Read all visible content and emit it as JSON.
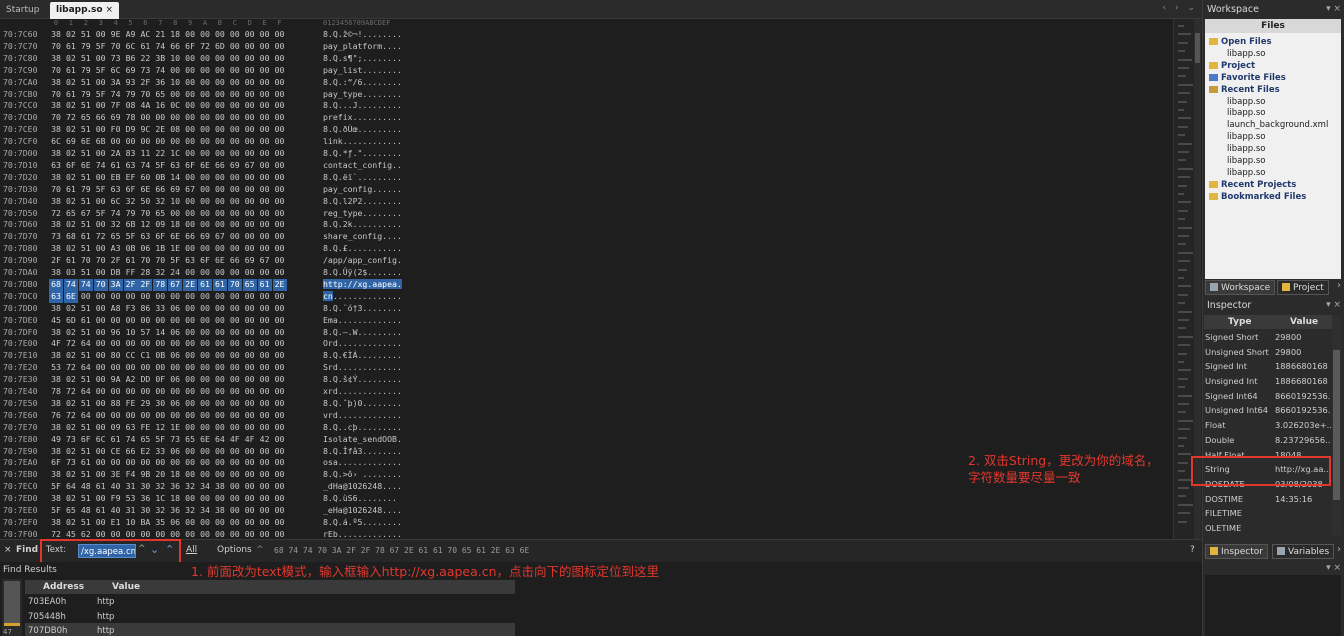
{
  "tabs": [
    {
      "label": "Startup",
      "active": false
    },
    {
      "label": "libapp.so",
      "active": true,
      "close": "×"
    }
  ],
  "tabnav": "‹ › ⌄",
  "hex_header": [
    "0",
    "1",
    "2",
    "3",
    "4",
    "5",
    "6",
    "7",
    "8",
    "9",
    "A",
    "B",
    "C",
    "D",
    "E",
    "F"
  ],
  "ascii_header": "0123456789ABCDEF",
  "rows": [
    {
      "addr": "70:7C60",
      "bytes": [
        "38",
        "02",
        "51",
        "00",
        "9E",
        "A9",
        "AC",
        "21",
        "18",
        "00",
        "00",
        "00",
        "00",
        "00",
        "00",
        "00"
      ],
      "ascii": "8.Q.ž©¬!........"
    },
    {
      "addr": "70:7C70",
      "bytes": [
        "70",
        "61",
        "79",
        "5F",
        "70",
        "6C",
        "61",
        "74",
        "66",
        "6F",
        "72",
        "6D",
        "00",
        "00",
        "00",
        "00"
      ],
      "ascii": "pay_platform...."
    },
    {
      "addr": "70:7C80",
      "bytes": [
        "38",
        "02",
        "51",
        "00",
        "73",
        "B6",
        "22",
        "3B",
        "10",
        "00",
        "00",
        "00",
        "00",
        "00",
        "00",
        "00"
      ],
      "ascii": "8.Q.s¶\";........"
    },
    {
      "addr": "70:7C90",
      "bytes": [
        "70",
        "61",
        "79",
        "5F",
        "6C",
        "69",
        "73",
        "74",
        "00",
        "00",
        "00",
        "00",
        "00",
        "00",
        "00",
        "00"
      ],
      "ascii": "pay_list........"
    },
    {
      "addr": "70:7CA0",
      "bytes": [
        "38",
        "02",
        "51",
        "00",
        "3A",
        "93",
        "2F",
        "36",
        "10",
        "00",
        "00",
        "00",
        "00",
        "00",
        "00",
        "00"
      ],
      "ascii": "8.Q.:“/6........"
    },
    {
      "addr": "70:7CB0",
      "bytes": [
        "70",
        "61",
        "79",
        "5F",
        "74",
        "79",
        "70",
        "65",
        "00",
        "00",
        "00",
        "00",
        "00",
        "00",
        "00",
        "00"
      ],
      "ascii": "pay_type........"
    },
    {
      "addr": "70:7CC0",
      "bytes": [
        "38",
        "02",
        "51",
        "00",
        "7F",
        "08",
        "4A",
        "16",
        "0C",
        "00",
        "00",
        "00",
        "00",
        "00",
        "00",
        "00"
      ],
      "ascii": "8.Q...J........."
    },
    {
      "addr": "70:7CD0",
      "bytes": [
        "70",
        "72",
        "65",
        "66",
        "69",
        "78",
        "00",
        "00",
        "00",
        "00",
        "00",
        "00",
        "00",
        "00",
        "00",
        "00"
      ],
      "ascii": "prefix.........."
    },
    {
      "addr": "70:7CE0",
      "bytes": [
        "38",
        "02",
        "51",
        "00",
        "F0",
        "D9",
        "9C",
        "2E",
        "08",
        "00",
        "00",
        "00",
        "00",
        "00",
        "00",
        "00"
      ],
      "ascii": "8.Q.ðÙœ........."
    },
    {
      "addr": "70:7CF0",
      "bytes": [
        "6C",
        "69",
        "6E",
        "6B",
        "00",
        "00",
        "00",
        "00",
        "00",
        "00",
        "00",
        "00",
        "00",
        "00",
        "00",
        "00"
      ],
      "ascii": "link............"
    },
    {
      "addr": "70:7D00",
      "bytes": [
        "38",
        "02",
        "51",
        "00",
        "2A",
        "83",
        "11",
        "22",
        "1C",
        "00",
        "00",
        "00",
        "00",
        "00",
        "00",
        "00"
      ],
      "ascii": "8.Q.*ƒ.\"........"
    },
    {
      "addr": "70:7D10",
      "bytes": [
        "63",
        "6F",
        "6E",
        "74",
        "61",
        "63",
        "74",
        "5F",
        "63",
        "6F",
        "6E",
        "66",
        "69",
        "67",
        "00",
        "00"
      ],
      "ascii": "contact_config.."
    },
    {
      "addr": "70:7D20",
      "bytes": [
        "38",
        "02",
        "51",
        "00",
        "EB",
        "EF",
        "60",
        "0B",
        "14",
        "00",
        "00",
        "00",
        "00",
        "00",
        "00",
        "00"
      ],
      "ascii": "8.Q.ëï`........."
    },
    {
      "addr": "70:7D30",
      "bytes": [
        "70",
        "61",
        "79",
        "5F",
        "63",
        "6F",
        "6E",
        "66",
        "69",
        "67",
        "00",
        "00",
        "00",
        "00",
        "00",
        "00"
      ],
      "ascii": "pay_config......"
    },
    {
      "addr": "70:7D40",
      "bytes": [
        "38",
        "02",
        "51",
        "00",
        "6C",
        "32",
        "50",
        "32",
        "10",
        "00",
        "00",
        "00",
        "00",
        "00",
        "00",
        "00"
      ],
      "ascii": "8.Q.l2P2........"
    },
    {
      "addr": "70:7D50",
      "bytes": [
        "72",
        "65",
        "67",
        "5F",
        "74",
        "79",
        "70",
        "65",
        "00",
        "00",
        "00",
        "00",
        "00",
        "00",
        "00",
        "00"
      ],
      "ascii": "reg_type........"
    },
    {
      "addr": "70:7D60",
      "bytes": [
        "38",
        "02",
        "51",
        "00",
        "32",
        "6B",
        "12",
        "09",
        "18",
        "00",
        "00",
        "00",
        "00",
        "00",
        "00",
        "00"
      ],
      "ascii": "8.Q.2k.........."
    },
    {
      "addr": "70:7D70",
      "bytes": [
        "73",
        "68",
        "61",
        "72",
        "65",
        "5F",
        "63",
        "6F",
        "6E",
        "66",
        "69",
        "67",
        "00",
        "00",
        "00",
        "00"
      ],
      "ascii": "share_config...."
    },
    {
      "addr": "70:7D80",
      "bytes": [
        "38",
        "02",
        "51",
        "00",
        "A3",
        "0B",
        "06",
        "1B",
        "1E",
        "00",
        "00",
        "00",
        "00",
        "00",
        "00",
        "00"
      ],
      "ascii": "8.Q.£..........."
    },
    {
      "addr": "70:7D90",
      "bytes": [
        "2F",
        "61",
        "70",
        "70",
        "2F",
        "61",
        "70",
        "70",
        "5F",
        "63",
        "6F",
        "6E",
        "66",
        "69",
        "67",
        "00"
      ],
      "ascii": "/app/app_config."
    },
    {
      "addr": "70:7DA0",
      "bytes": [
        "38",
        "03",
        "51",
        "00",
        "DB",
        "FF",
        "28",
        "32",
        "24",
        "00",
        "00",
        "00",
        "00",
        "00",
        "00",
        "00"
      ],
      "ascii": "8.Q.Ûÿ(2$......."
    },
    {
      "addr": "70:7DB0",
      "bytes": [
        "68",
        "74",
        "74",
        "70",
        "3A",
        "2F",
        "2F",
        "78",
        "67",
        "2E",
        "61",
        "61",
        "70",
        "65",
        "61",
        "2E"
      ],
      "ascii": "http://xg.aapea.",
      "sel": 16
    },
    {
      "addr": "70:7DC0",
      "bytes": [
        "63",
        "6E",
        "00",
        "00",
        "00",
        "00",
        "00",
        "00",
        "00",
        "00",
        "00",
        "00",
        "00",
        "00",
        "00",
        "00"
      ],
      "ascii": "cn..............",
      "sel": 2
    },
    {
      "addr": "70:7DD0",
      "bytes": [
        "38",
        "02",
        "51",
        "00",
        "A8",
        "F3",
        "86",
        "33",
        "06",
        "00",
        "00",
        "00",
        "00",
        "00",
        "00",
        "00"
      ],
      "ascii": "8.Q.¨ó†3........"
    },
    {
      "addr": "70:7DE0",
      "bytes": [
        "45",
        "6D",
        "61",
        "00",
        "00",
        "00",
        "00",
        "00",
        "00",
        "00",
        "00",
        "00",
        "00",
        "00",
        "00",
        "00"
      ],
      "ascii": "Ema............."
    },
    {
      "addr": "70:7DF0",
      "bytes": [
        "38",
        "02",
        "51",
        "00",
        "96",
        "10",
        "57",
        "14",
        "06",
        "00",
        "00",
        "00",
        "00",
        "00",
        "00",
        "00"
      ],
      "ascii": "8.Q.–.W........."
    },
    {
      "addr": "70:7E00",
      "bytes": [
        "4F",
        "72",
        "64",
        "00",
        "00",
        "00",
        "00",
        "00",
        "00",
        "00",
        "00",
        "00",
        "00",
        "00",
        "00",
        "00"
      ],
      "ascii": "Ord............."
    },
    {
      "addr": "70:7E10",
      "bytes": [
        "38",
        "02",
        "51",
        "00",
        "80",
        "CC",
        "C1",
        "0B",
        "06",
        "00",
        "00",
        "00",
        "00",
        "00",
        "00",
        "00"
      ],
      "ascii": "8.Q.€ÌÁ........."
    },
    {
      "addr": "70:7E20",
      "bytes": [
        "53",
        "72",
        "64",
        "00",
        "00",
        "00",
        "00",
        "00",
        "00",
        "00",
        "00",
        "00",
        "00",
        "00",
        "00",
        "00"
      ],
      "ascii": "Srd............."
    },
    {
      "addr": "70:7E30",
      "bytes": [
        "38",
        "02",
        "51",
        "00",
        "9A",
        "A2",
        "DD",
        "0F",
        "06",
        "00",
        "00",
        "00",
        "00",
        "00",
        "00",
        "00"
      ],
      "ascii": "8.Q.š¢Ý........."
    },
    {
      "addr": "70:7E40",
      "bytes": [
        "78",
        "72",
        "64",
        "00",
        "00",
        "00",
        "00",
        "00",
        "00",
        "00",
        "00",
        "00",
        "00",
        "00",
        "00",
        "00"
      ],
      "ascii": "xrd............."
    },
    {
      "addr": "70:7E50",
      "bytes": [
        "38",
        "02",
        "51",
        "00",
        "88",
        "FE",
        "29",
        "30",
        "06",
        "00",
        "00",
        "00",
        "00",
        "00",
        "00",
        "00"
      ],
      "ascii": "8.Q.ˆþ)0........"
    },
    {
      "addr": "70:7E60",
      "bytes": [
        "76",
        "72",
        "64",
        "00",
        "00",
        "00",
        "00",
        "00",
        "00",
        "00",
        "00",
        "00",
        "00",
        "00",
        "00",
        "00"
      ],
      "ascii": "vrd............."
    },
    {
      "addr": "70:7E70",
      "bytes": [
        "38",
        "02",
        "51",
        "00",
        "09",
        "63",
        "FE",
        "12",
        "1E",
        "00",
        "00",
        "00",
        "00",
        "00",
        "00",
        "00"
      ],
      "ascii": "8.Q..cþ........."
    },
    {
      "addr": "70:7E80",
      "bytes": [
        "49",
        "73",
        "6F",
        "6C",
        "61",
        "74",
        "65",
        "5F",
        "73",
        "65",
        "6E",
        "64",
        "4F",
        "4F",
        "42",
        "00"
      ],
      "ascii": "Isolate_sendOOB."
    },
    {
      "addr": "70:7E90",
      "bytes": [
        "38",
        "02",
        "51",
        "00",
        "CE",
        "66",
        "E2",
        "33",
        "06",
        "00",
        "00",
        "00",
        "00",
        "00",
        "00",
        "00"
      ],
      "ascii": "8.Q.Îfâ3........"
    },
    {
      "addr": "70:7EA0",
      "bytes": [
        "6F",
        "73",
        "61",
        "00",
        "00",
        "00",
        "00",
        "00",
        "00",
        "00",
        "00",
        "00",
        "00",
        "00",
        "00",
        "00"
      ],
      "ascii": "osa............."
    },
    {
      "addr": "70:7EB0",
      "bytes": [
        "38",
        "02",
        "51",
        "00",
        "3E",
        "F4",
        "9B",
        "20",
        "18",
        "00",
        "00",
        "00",
        "00",
        "00",
        "00",
        "00"
      ],
      "ascii": "8.Q.>ô› ........"
    },
    {
      "addr": "70:7EC0",
      "bytes": [
        "5F",
        "64",
        "48",
        "61",
        "40",
        "31",
        "30",
        "32",
        "36",
        "32",
        "34",
        "38",
        "00",
        "00",
        "00",
        "00"
      ],
      "ascii": "_dHa@1026248...."
    },
    {
      "addr": "70:7ED0",
      "bytes": [
        "38",
        "02",
        "51",
        "00",
        "F9",
        "53",
        "36",
        "1C",
        "18",
        "00",
        "00",
        "00",
        "00",
        "00",
        "00",
        "00"
      ],
      "ascii": "8.Q.ùS6........"
    },
    {
      "addr": "70:7EE0",
      "bytes": [
        "5F",
        "65",
        "48",
        "61",
        "40",
        "31",
        "30",
        "32",
        "36",
        "32",
        "34",
        "38",
        "00",
        "00",
        "00",
        "00"
      ],
      "ascii": "_eHa@1026248...."
    },
    {
      "addr": "70:7EF0",
      "bytes": [
        "38",
        "02",
        "51",
        "00",
        "E1",
        "10",
        "BA",
        "35",
        "06",
        "00",
        "00",
        "00",
        "00",
        "00",
        "00",
        "00"
      ],
      "ascii": "8.Q.á.º5........"
    },
    {
      "addr": "70:7F00",
      "bytes": [
        "72",
        "45",
        "62",
        "00",
        "00",
        "00",
        "00",
        "00",
        "00",
        "00",
        "00",
        "00",
        "00",
        "00",
        "00",
        "00"
      ],
      "ascii": "rEb............."
    }
  ],
  "annotation2": "2. 双击String，更改为你的域名，字符数量要尽量一致",
  "annotation1": "1. 前面改为text模式，输入框输入http://xg.aapea.cn，点击向下的图标定位到这里",
  "findbar": {
    "close": "×",
    "label": "Find",
    "mode_label": "Text:",
    "input_value": "/xg.aapea.cn",
    "all_label": "All",
    "options_label": "Options",
    "hex_pattern": "68 74 74 70 3A 2F 2F 78 67 2E 61 61 70 65 61 2E 63 6E",
    "help": "?"
  },
  "results": {
    "title": "Find Results",
    "columns": [
      "Address",
      "Value"
    ],
    "rows": [
      {
        "address": "703EA0h",
        "value": "http"
      },
      {
        "address": "705448h",
        "value": "http"
      },
      {
        "address": "707DB0h",
        "value": "http"
      }
    ],
    "gutter_num": "47"
  },
  "workspace": {
    "title": "Workspace",
    "ctl": "▾ ×",
    "files_title": "Files",
    "tree": [
      {
        "label": "Open Files",
        "bold": true,
        "icon": "folder"
      },
      {
        "label": "libapp.so",
        "bold": false
      },
      {
        "label": "Project",
        "bold": true,
        "icon": "folder"
      },
      {
        "label": "Favorite Files",
        "bold": true,
        "icon": "star"
      },
      {
        "label": "Recent Files",
        "bold": true,
        "icon": "recent"
      },
      {
        "label": "libapp.so",
        "bold": false
      },
      {
        "label": "libapp.so",
        "bold": false
      },
      {
        "label": "launch_background.xml",
        "bold": false
      },
      {
        "label": "libapp.so",
        "bold": false
      },
      {
        "label": "libapp.so",
        "bold": false
      },
      {
        "label": "libapp.so",
        "bold": false
      },
      {
        "label": "libapp.so",
        "bold": false
      },
      {
        "label": "Recent Projects",
        "bold": true,
        "icon": "folder"
      },
      {
        "label": "Bookmarked Files",
        "bold": true,
        "icon": "folder"
      }
    ],
    "tabs": [
      "Workspace",
      "Project"
    ],
    "tabs_more": "›"
  },
  "inspector": {
    "title": "Inspector",
    "ctl": "▾ ×",
    "columns": [
      "Type",
      "Value"
    ],
    "rows": [
      {
        "type": "Signed Short",
        "value": "29800"
      },
      {
        "type": "Unsigned Short",
        "value": "29800"
      },
      {
        "type": "Signed Int",
        "value": "1886680168"
      },
      {
        "type": "Unsigned Int",
        "value": "1886680168"
      },
      {
        "type": "Signed Int64",
        "value": "8660192536..."
      },
      {
        "type": "Unsigned Int64",
        "value": "8660192536..."
      },
      {
        "type": "Float",
        "value": "3.026203e+..."
      },
      {
        "type": "Double",
        "value": "8.23729656..."
      },
      {
        "type": "Half Float",
        "value": "18048"
      },
      {
        "type": "String",
        "value": "http://xg.aa..."
      },
      {
        "type": "DOSDATE",
        "value": "03/08/2038"
      },
      {
        "type": "DOSTIME",
        "value": "14:35:16"
      },
      {
        "type": "FILETIME",
        "value": ""
      },
      {
        "type": "OLETIME",
        "value": ""
      }
    ],
    "tabs": [
      "Inspector",
      "Variables"
    ],
    "tabs_more": "›"
  },
  "colors": {
    "selection": "#2f65a7",
    "annotation": "#e3372d",
    "background": "#1e1e1e",
    "panel": "#2b2b2b"
  }
}
